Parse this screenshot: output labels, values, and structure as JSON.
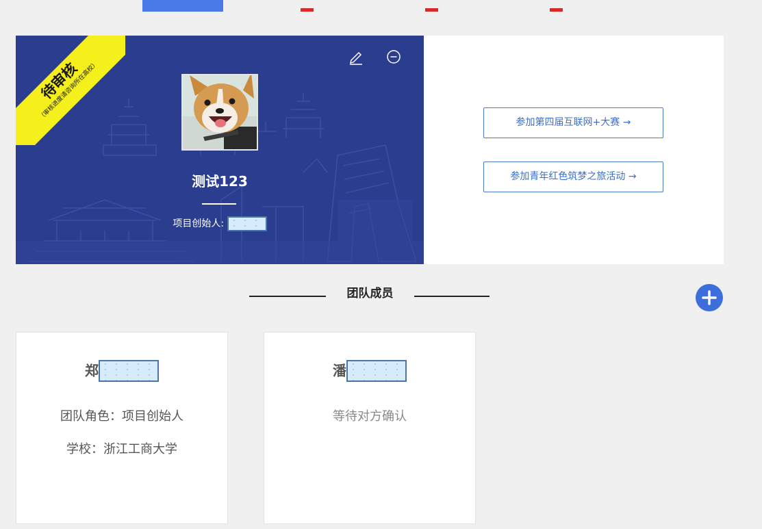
{
  "colors": {
    "page_bg": "#f0f0f0",
    "banner_bg": "#2b3d8f",
    "ribbon": "#f5ef1c",
    "accent_blue": "#3d6fdc",
    "tab_active": "#4a7ae8",
    "tab_marker": "#d92a2a"
  },
  "project": {
    "status_ribbon": {
      "title": "待审核",
      "subtitle": "（审核进度请咨询所在高校）"
    },
    "icons": {
      "edit": "pencil-icon",
      "remove": "minus-circle-icon"
    },
    "name": "测试123",
    "founder_label": "项目创始人:"
  },
  "actions": {
    "join_contest": "参加第四届互联网+大赛 →",
    "join_red_tour": "参加青年红色筑梦之旅活动 →"
  },
  "team": {
    "title": "团队成员",
    "add_icon": "plus-circle-icon",
    "members": [
      {
        "surname": "郑",
        "role": "团队角色：项目创始人",
        "school": "学校：浙江工商大学"
      },
      {
        "surname": "潘",
        "status": "等待对方确认"
      }
    ]
  }
}
